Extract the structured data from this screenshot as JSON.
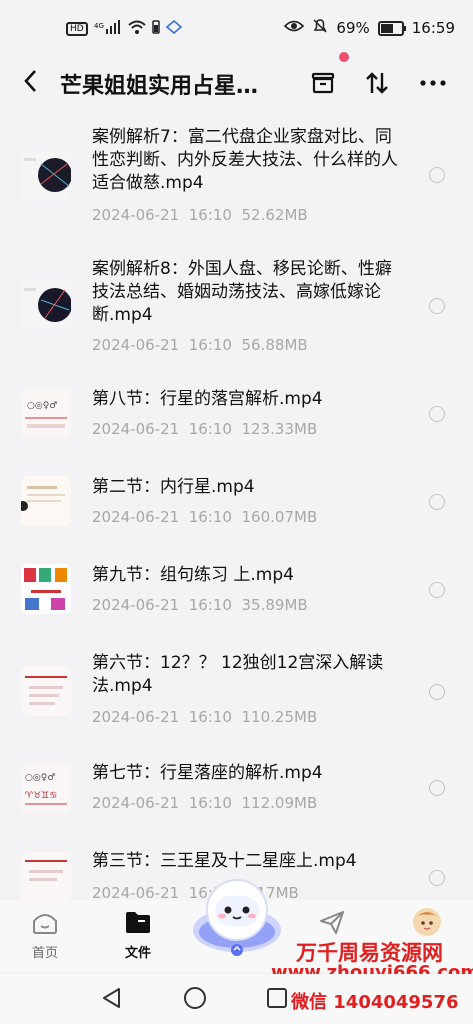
{
  "status": {
    "left": [
      "HD",
      "4G"
    ],
    "battery_percent": "69%",
    "battery_level": 0.69,
    "time": "16:59"
  },
  "header": {
    "title": "芒果姐姐实用占星…"
  },
  "files": [
    {
      "name": "案例解析7：富二代盘企业家盘对比、同性恋判断、内外反差大技法、什么样的人适合做慈.mp4",
      "date": "2024-06-21",
      "time": "16:10",
      "size": "52.62MB"
    },
    {
      "name": "案例解析8：外国人盘、移民论断、性癖技法总结、婚姻动荡技法、高嫁低嫁论断.mp4",
      "date": "2024-06-21",
      "time": "16:10",
      "size": "56.88MB"
    },
    {
      "name": "第八节：行星的落宫解析.mp4",
      "date": "2024-06-21",
      "time": "16:10",
      "size": "123.33MB"
    },
    {
      "name": "第二节：内行星.mp4",
      "date": "2024-06-21",
      "time": "16:10",
      "size": "160.07MB"
    },
    {
      "name": "第九节：组句练习 上.mp4",
      "date": "2024-06-21",
      "time": "16:10",
      "size": "35.89MB"
    },
    {
      "name": "第六节：12？？ 12独创12宫深入解读法.mp4",
      "date": "2024-06-21",
      "time": "16:10",
      "size": "110.25MB"
    },
    {
      "name": "第七节：行星落座的解析.mp4",
      "date": "2024-06-21",
      "time": "16:10",
      "size": "112.09MB"
    },
    {
      "name": "第三节：三王星及十二星座上.mp4",
      "date": "2024-06-21",
      "time": "16:10",
      "size": "…17MB"
    }
  ],
  "nav": {
    "home": "首页",
    "files": "文件"
  },
  "watermark": {
    "line1": "万千周易资源网",
    "line2": "www.zhouyi666.com",
    "line3": "微信 1404049576"
  }
}
